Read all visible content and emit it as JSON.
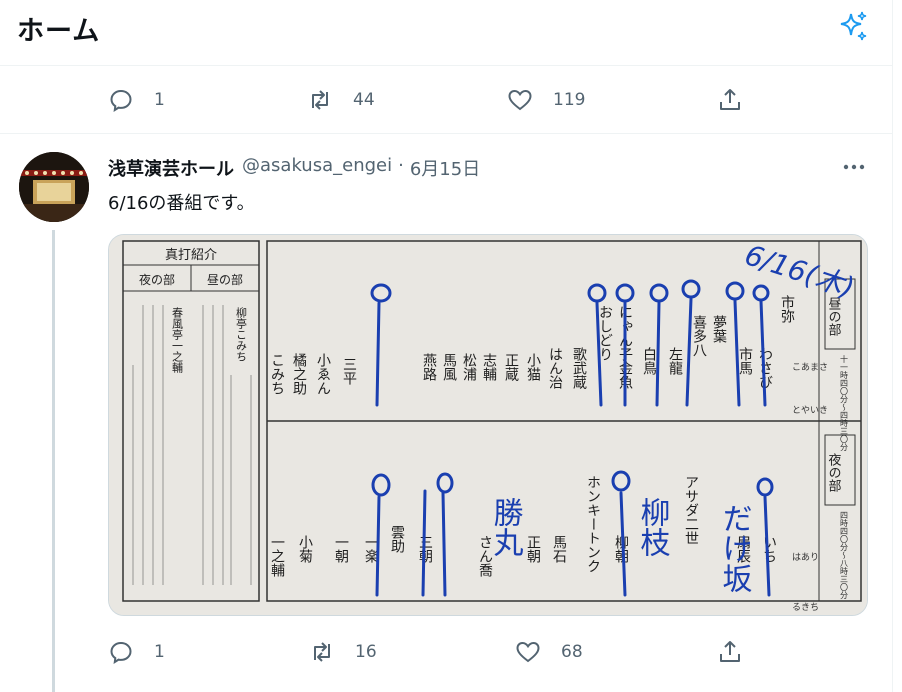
{
  "header": {
    "title": "ホーム",
    "sparkle_icon": "sparkle-icon"
  },
  "prev_tweet_actions": {
    "replies": "1",
    "retweets": "44",
    "likes": "119"
  },
  "tweet": {
    "author_name": "浅草演芸ホール",
    "handle": "@asakusa_engei",
    "separator": "·",
    "date": "6月15日",
    "text": "6/16の番組です。",
    "actions": {
      "replies": "1",
      "retweets": "16",
      "likes": "68"
    }
  },
  "program": {
    "header_box": "真打紹介",
    "evening_label": "夜の部",
    "day_label": "昼の部",
    "intro_name": "柳亭こみち",
    "intro_second": "春風亭一之輔",
    "day_title": "昼の部",
    "day_time": "十一時四〇分〜四時三〇分",
    "night_title": "夜の部",
    "night_time": "四時四〇分〜八時三〇分",
    "handwritten_date": "6/16(木)",
    "day_performers": [
      "こみち",
      "橘之助",
      "小ゑん",
      "三平",
      "燕路",
      "馬風",
      "松浦",
      "志輔",
      "正蔵",
      "小猫",
      "はん治",
      "歌武蔵",
      "おしどり",
      "にゃん子金魚",
      "白鳥",
      "左龍",
      "喜多八",
      "夢葉",
      "市馬",
      "わさび",
      "市弥"
    ],
    "night_performers": [
      "一之輔",
      "小菊",
      "一朝",
      "一楽",
      "雲助",
      "三朝",
      "さん喬",
      "正朝",
      "馬石",
      "ホンキートンク",
      "柳朝",
      "アサダ二世",
      "扇辰",
      "いち"
    ],
    "handwritten_names": [
      "勝丸",
      "柳枝",
      "だけ坂"
    ],
    "foot_labels": [
      "とやいき",
      "るきち"
    ],
    "margin_labels": [
      "こあまさ",
      "はあり"
    ]
  }
}
